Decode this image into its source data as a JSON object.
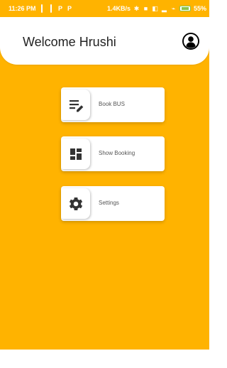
{
  "status_bar": {
    "time": "11:26 PM",
    "network_speed": "1.4KB/s",
    "battery": "55%"
  },
  "header": {
    "welcome_text": "Welcome Hrushi",
    "avatar_icon": "account-circle-icon"
  },
  "menu": {
    "items": [
      {
        "label": "Book BUS",
        "icon": "edit-list-icon"
      },
      {
        "label": "Show Booking",
        "icon": "dashboard-icon"
      },
      {
        "label": "Settings",
        "icon": "gear-icon"
      }
    ]
  },
  "colors": {
    "background": "#ffb300",
    "card": "#ffffff",
    "text": "#222222"
  }
}
